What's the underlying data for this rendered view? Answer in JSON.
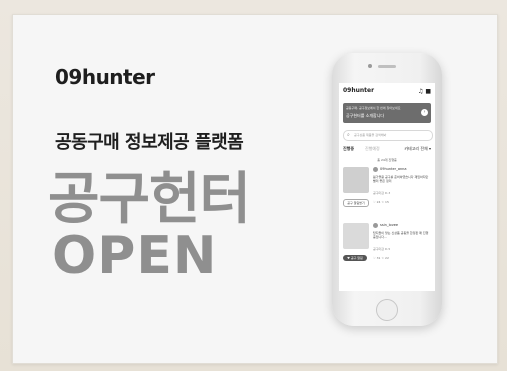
{
  "brand": {
    "logo": "09hunter"
  },
  "hero": {
    "tagline": "공동구매 정보제공 플랫폼",
    "headline": "공구헌터",
    "headline_sub": "OPEN"
  },
  "phone_screen": {
    "logo": "09hunter",
    "icons": "♫ ■",
    "banner": {
      "line1": "공동구매, 공구정보에서 한 번에 찾아보세요",
      "line2": "공구헌터를 소개합니다",
      "arrow": "›"
    },
    "search": {
      "icon": "⌕",
      "placeholder": "공구상품 제품을 검색해봐"
    },
    "tabs": {
      "active": "진행중",
      "inactive": "진행예정",
      "category": "카테고리 전체 ▾"
    },
    "sub_label": "총 24개 진행중",
    "items": [
      {
        "username": "09hunter_anna",
        "description": "봄가을용 공구를 준비하였습니다 재입하지만 빨리 좋은 정리",
        "meta": "공구마감 D-3",
        "button": "공구 알림받기",
        "counts": "♡ 24   ☆ 15"
      },
      {
        "username": "ssin_lovee",
        "description": "탑지들이 맞는 신상품 공동을 한정판 매 진행 중입니다...",
        "meta": "공구마감 D-5",
        "button": "♥ 공구 알림",
        "counts": "♡ 31   ☆ 22"
      }
    ]
  }
}
